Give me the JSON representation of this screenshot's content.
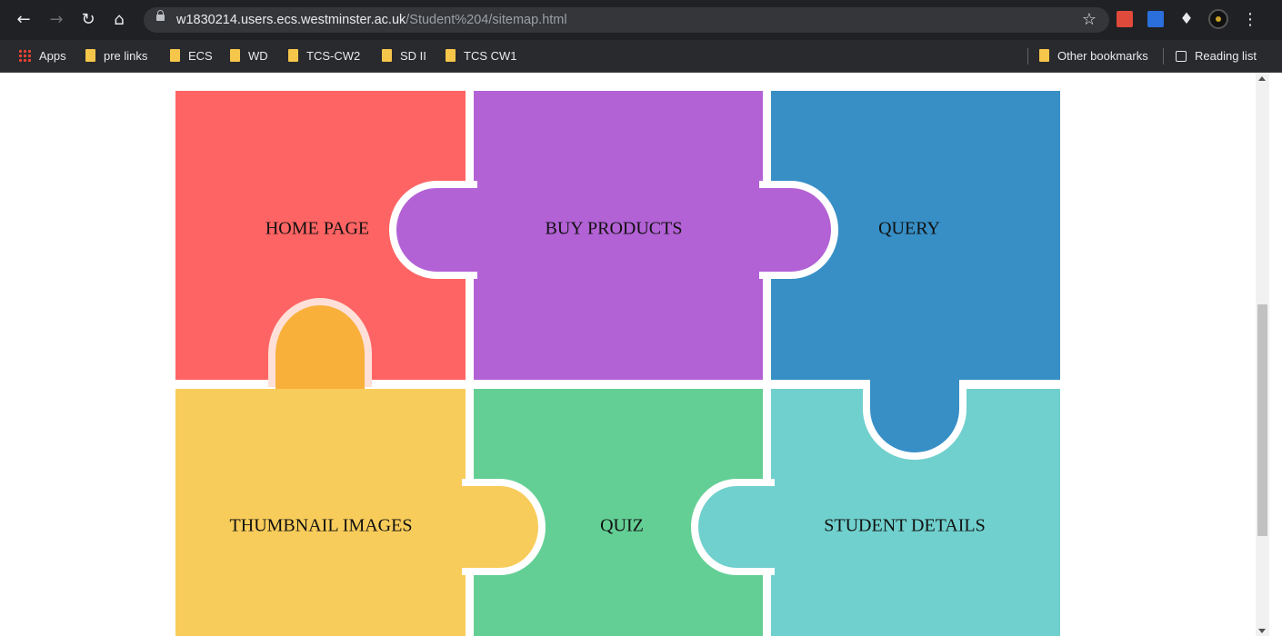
{
  "browser": {
    "url_host": "w1830214.users.ecs.westminster.ac.uk",
    "url_path": "/Student%204/sitemap.html"
  },
  "bookmarks": {
    "apps": "Apps",
    "items": [
      "pre links",
      "ECS",
      "WD",
      "TCS-CW2",
      "SD II",
      "TCS CW1"
    ],
    "other": "Other bookmarks",
    "reading_list": "Reading list"
  },
  "sitemap": {
    "pieces": [
      {
        "label": "HOME PAGE",
        "color": "#ff6464"
      },
      {
        "label": "BUY PRODUCTS",
        "color": "#b362d6"
      },
      {
        "label": "QUERY",
        "color": "#378fc6"
      },
      {
        "label": "THUMBNAIL IMAGES",
        "color": "#f8cc5a"
      },
      {
        "label": "QUIZ",
        "color": "#64cf95"
      },
      {
        "label": "STUDENT DETAILS",
        "color": "#70d0cd"
      }
    ],
    "knob_color": "#f8b03a"
  }
}
